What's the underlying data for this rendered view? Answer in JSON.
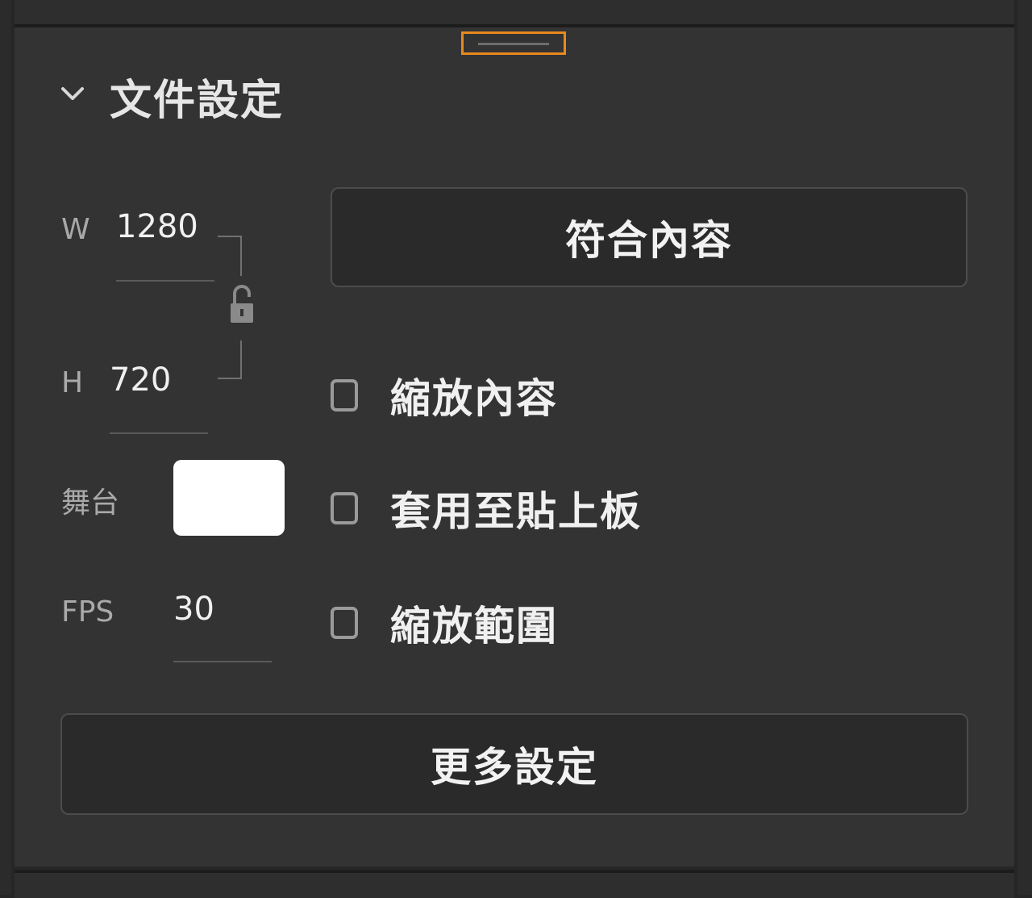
{
  "panel": {
    "section_title": "文件設定",
    "width_label": "W",
    "width_value": "1280",
    "height_label": "H",
    "height_value": "720",
    "stage_label": "舞台",
    "stage_color": "#ffffff",
    "fps_label": "FPS",
    "fps_value": "30",
    "fit_content_button": "符合內容",
    "checkboxes": [
      {
        "label": "縮放內容",
        "checked": false
      },
      {
        "label": "套用至貼上板",
        "checked": false
      },
      {
        "label": "縮放範圍",
        "checked": false
      }
    ],
    "more_settings_button": "更多設定"
  },
  "colors": {
    "panel_bg": "#333333",
    "accent_focus": "#e8891e",
    "button_bg": "#2a2a2a"
  },
  "icons": {
    "chevron": "chevron-down-icon",
    "lock": "unlock-icon"
  }
}
